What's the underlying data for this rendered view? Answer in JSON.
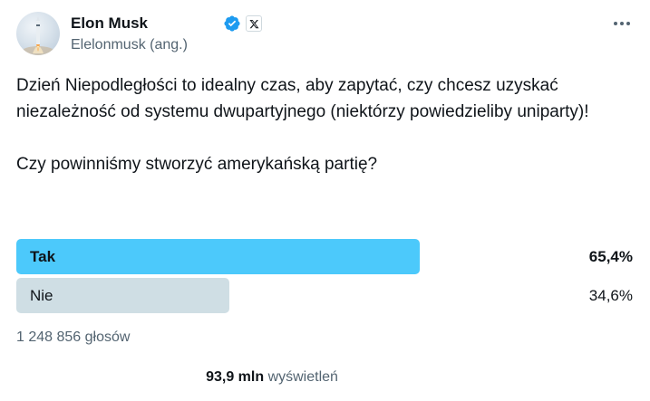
{
  "author": {
    "name": "Elon Musk",
    "handle": "Elelonmusk (ang.)",
    "verified_color": "#1d9bf0"
  },
  "tweet": {
    "paragraphs": [
      "Dzień Niepodległości to idealny czas, aby zapytać, czy chcesz uzyskać niezależność od systemu dwupartyjnego (niektórzy powiedzieliby uniparty)!",
      "Czy powinniśmy stworzyć amerykańską partię?"
    ]
  },
  "poll": {
    "options": [
      {
        "label": "Tak",
        "percent_text": "65,4%",
        "fraction": 0.654,
        "winner": true,
        "bar_color": "#4cc9fb"
      },
      {
        "label": "Nie",
        "percent_text": "34,6%",
        "fraction": 0.346,
        "winner": false,
        "bar_color": "#cfdee4"
      }
    ],
    "votes": "1 248 856 głosów"
  },
  "stats": {
    "views_count": "93,9 mln",
    "views_label": "wyświetleń"
  },
  "icons": {
    "verified": "verified-badge-icon",
    "affiliation": "x-logo-icon",
    "more": "more-horizontal-icon"
  }
}
